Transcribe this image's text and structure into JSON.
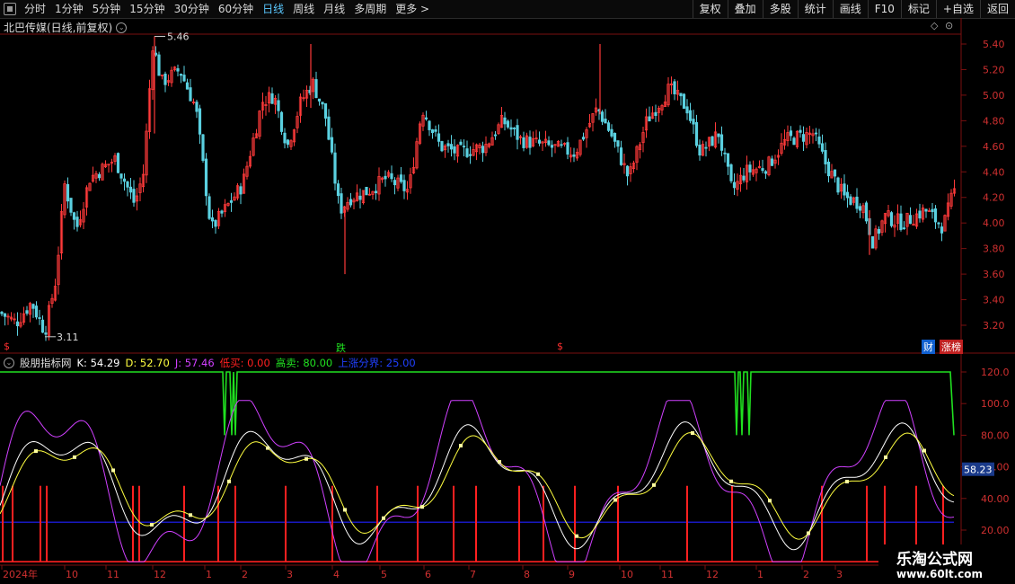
{
  "toolbar": {
    "tabs": [
      {
        "label": "分时",
        "active": false
      },
      {
        "label": "1分钟",
        "active": false
      },
      {
        "label": "5分钟",
        "active": false
      },
      {
        "label": "15分钟",
        "active": false
      },
      {
        "label": "30分钟",
        "active": false
      },
      {
        "label": "60分钟",
        "active": false
      },
      {
        "label": "日线",
        "active": true
      },
      {
        "label": "周线",
        "active": false
      },
      {
        "label": "月线",
        "active": false
      },
      {
        "label": "多周期",
        "active": false
      },
      {
        "label": "更多 >",
        "active": false
      }
    ],
    "right": [
      "复权",
      "叠加",
      "多股",
      "统计",
      "画线",
      "F10",
      "标记",
      "+自选",
      "返回"
    ]
  },
  "main": {
    "title": "北巴传媒(日线,前复权)",
    "price_ticks": [
      "5.40",
      "5.20",
      "5.00",
      "4.80",
      "4.60",
      "4.40",
      "4.20",
      "4.00",
      "3.80",
      "3.60",
      "3.40",
      "3.20"
    ],
    "high_label": "5.46",
    "low_label": "3.11",
    "markers": {
      "s1": "$",
      "s2": "$",
      "die": "跌",
      "cai": "财",
      "zhang": "涨榜"
    }
  },
  "indicator": {
    "name": "股朋指标网",
    "k": "K: 54.29",
    "d": "D: 52.70",
    "j": "J: 57.46",
    "low_buy": "低买: 0.00",
    "high_sell": "高卖: 80.00",
    "rise_bound": "上涨分界: 25.00",
    "ticks": [
      "120.0",
      "100.0",
      "80.00",
      "60.00",
      "40.00",
      "20.00"
    ],
    "current": "58.23"
  },
  "xaxis": [
    "2024年",
    "10",
    "11",
    "12",
    "1",
    "2",
    "3",
    "4",
    "5",
    "6",
    "7",
    "8",
    "9",
    "10",
    "11",
    "12",
    "1",
    "2",
    "3"
  ],
  "watermark": {
    "line1": "乐淘公式网",
    "line2": "www.60lt.com"
  },
  "colors": {
    "up": "#ff3a3a",
    "down": "#5ad0e0",
    "k": "#ffffff",
    "d": "#ffff40",
    "j": "#d040ff",
    "green": "#20e020",
    "red": "#ff2020",
    "blue": "#2020ff"
  }
}
